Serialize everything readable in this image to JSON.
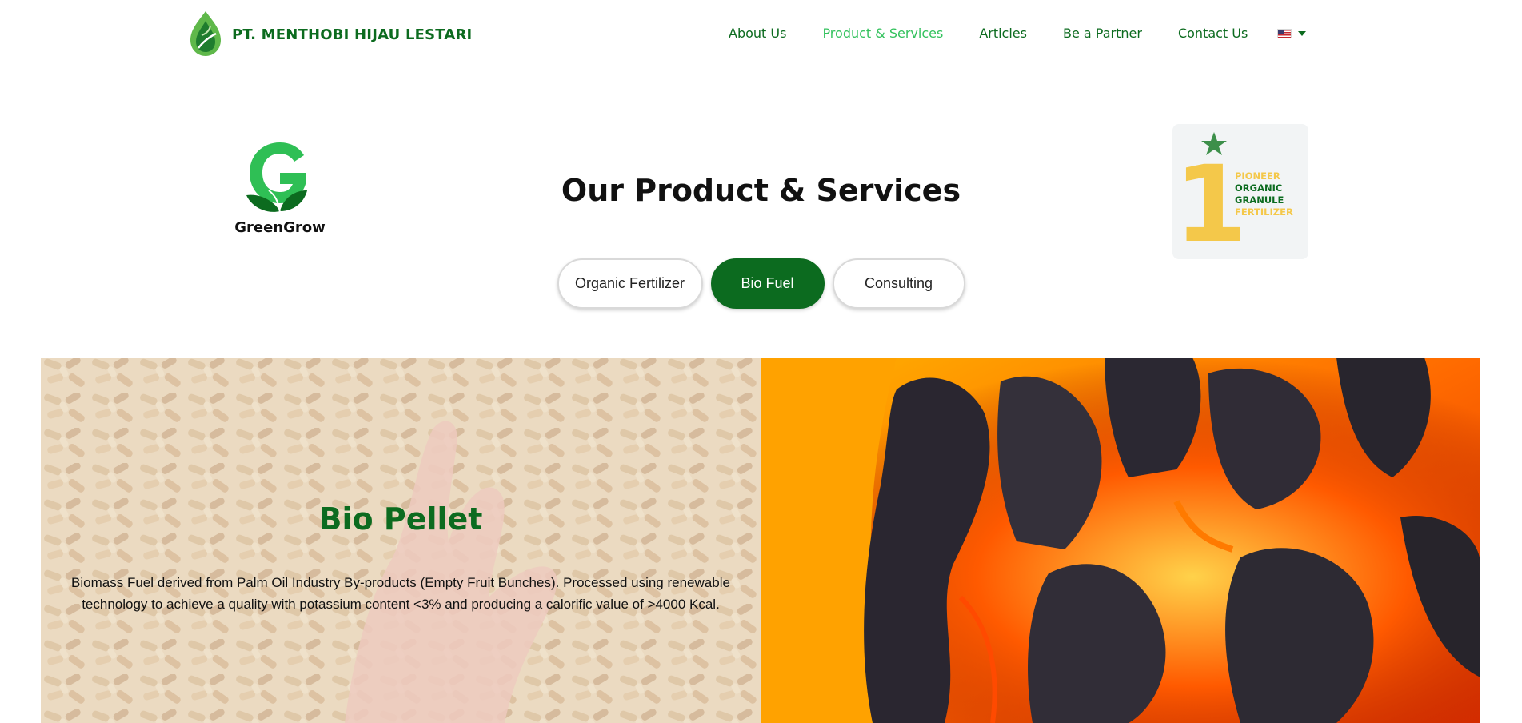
{
  "header": {
    "company_name": "PT. MENTHOBI HIJAU LESTARI",
    "nav": [
      {
        "label": "About Us",
        "active": false
      },
      {
        "label": "Product & Services",
        "active": true
      },
      {
        "label": "Articles",
        "active": false
      },
      {
        "label": "Be a Partner",
        "active": false
      },
      {
        "label": "Contact Us",
        "active": false
      }
    ],
    "language_icon": "us-flag-icon"
  },
  "hero": {
    "brand_logo_text": "GreenGrow",
    "title": "Our Product & Services",
    "badge": {
      "number": "1",
      "line1": "PIONEER",
      "line2": "ORGANIC",
      "line3": "GRANULE",
      "line4": "FERTILIZER"
    }
  },
  "tabs": [
    {
      "label": "Organic Fertilizer",
      "selected": false
    },
    {
      "label": "Bio Fuel",
      "selected": true
    },
    {
      "label": "Consulting",
      "selected": false
    }
  ],
  "product": {
    "name": "Bio Pellet",
    "description": "Biomass Fuel derived from Palm Oil Industry By-products (Empty Fruit Bunches). Processed using renewable technology to achieve a quality with potassium content <3% and producing a calorific value of >4000 Kcal."
  },
  "colors": {
    "brand_green": "#0c6b1f",
    "active_nav": "#34c25e",
    "badge_yellow": "#f4c84a"
  }
}
